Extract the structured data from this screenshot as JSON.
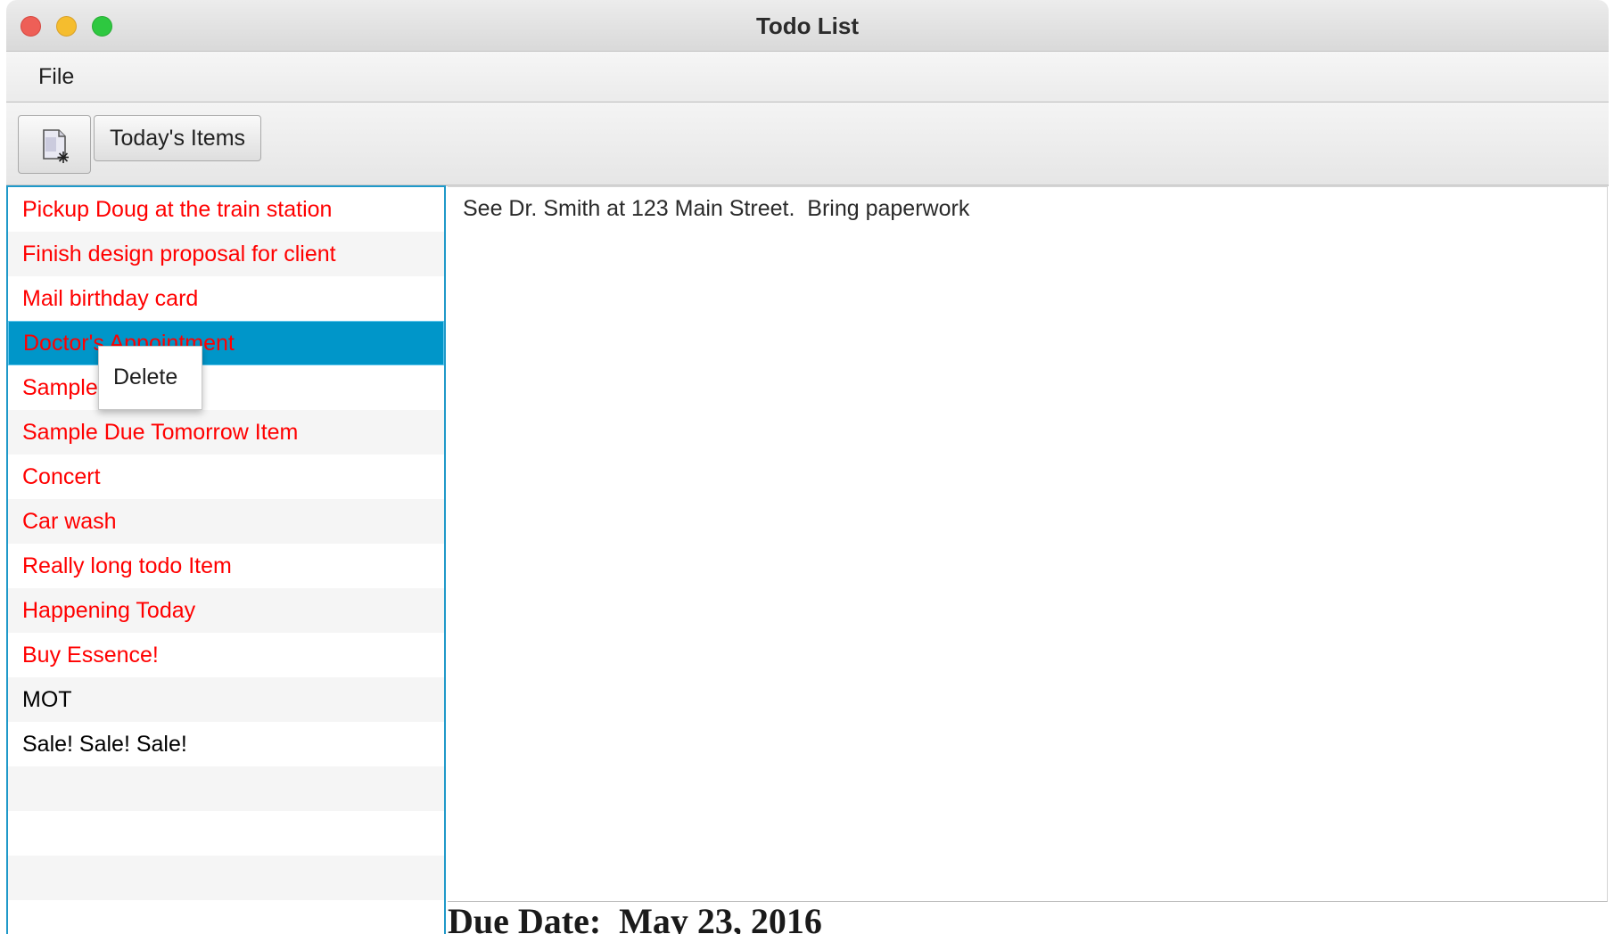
{
  "window": {
    "title": "Todo List"
  },
  "menu": {
    "file_label": "File"
  },
  "toolbar": {
    "new_item_icon": "new-document-icon",
    "today_label": "Today's Items"
  },
  "todo_list": {
    "items": [
      {
        "label": "Pickup Doug at the train station",
        "color": "#ff0000"
      },
      {
        "label": "Finish design proposal for client",
        "color": "#ff0000"
      },
      {
        "label": "Mail birthday card",
        "color": "#ff0000"
      },
      {
        "label": "Doctor's Appointment",
        "color": "#ff0000",
        "selected": true
      },
      {
        "label": "Sample",
        "color": "#ff0000"
      },
      {
        "label": "Sample Due Tomorrow Item",
        "color": "#ff0000"
      },
      {
        "label": "Concert",
        "color": "#ff0000"
      },
      {
        "label": "Car wash",
        "color": "#ff0000"
      },
      {
        "label": "Really  long todo Item",
        "color": "#ff0000"
      },
      {
        "label": "Happening Today",
        "color": "#ff0000"
      },
      {
        "label": "Buy Essence!",
        "color": "#ff0000"
      },
      {
        "label": "MOT",
        "color": "#000000"
      },
      {
        "label": "Sale! Sale! Sale!",
        "color": "#000000"
      }
    ],
    "selection_color": "#0096c9"
  },
  "context_menu": {
    "delete_label": "Delete"
  },
  "details": {
    "text": "See Dr. Smith at 123 Main Street.  Bring paperwork",
    "due_date": "Due Date:  May 23, 2016"
  }
}
